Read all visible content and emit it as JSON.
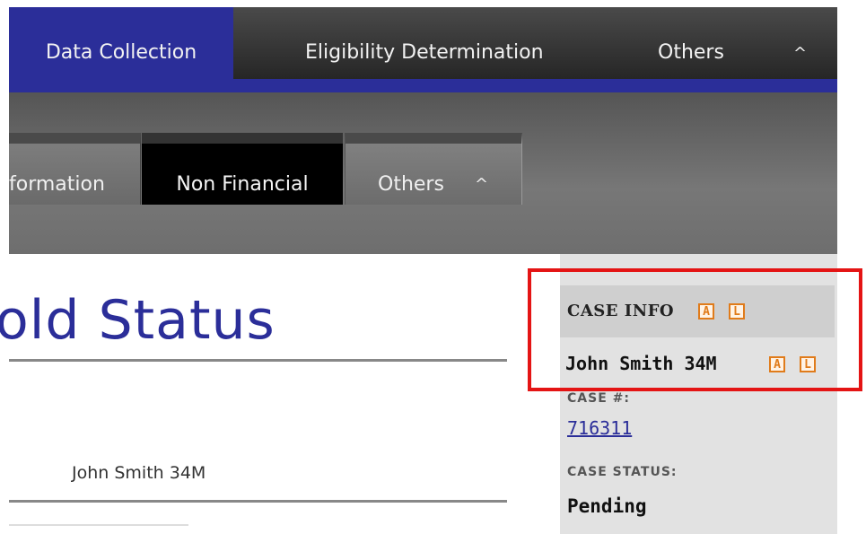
{
  "top_nav": {
    "tabs": [
      {
        "label": "Data Collection",
        "active": true
      },
      {
        "label": "Eligibility Determination",
        "active": false
      },
      {
        "label": "Others",
        "active": false
      }
    ],
    "caret": "^"
  },
  "sub_nav": {
    "tabs": [
      {
        "label": "formation"
      },
      {
        "label": "Non Financial",
        "active": true
      },
      {
        "label": "Others"
      }
    ],
    "caret": "^"
  },
  "main": {
    "title": "hold Status",
    "member": "John Smith 34M"
  },
  "case_panel": {
    "heading": "CASE INFO",
    "badge_a": "A",
    "badge_l": "L",
    "person": "John Smith 34M",
    "case_number_label": "CASE #:",
    "case_number": "716311",
    "case_status_label": "CASE STATUS:",
    "case_status": "Pending"
  },
  "colors": {
    "accent": "#2b2e99",
    "badge": "#e07b1a",
    "highlight": "#e41414"
  },
  "icons": [
    "caret-up-icon"
  ]
}
